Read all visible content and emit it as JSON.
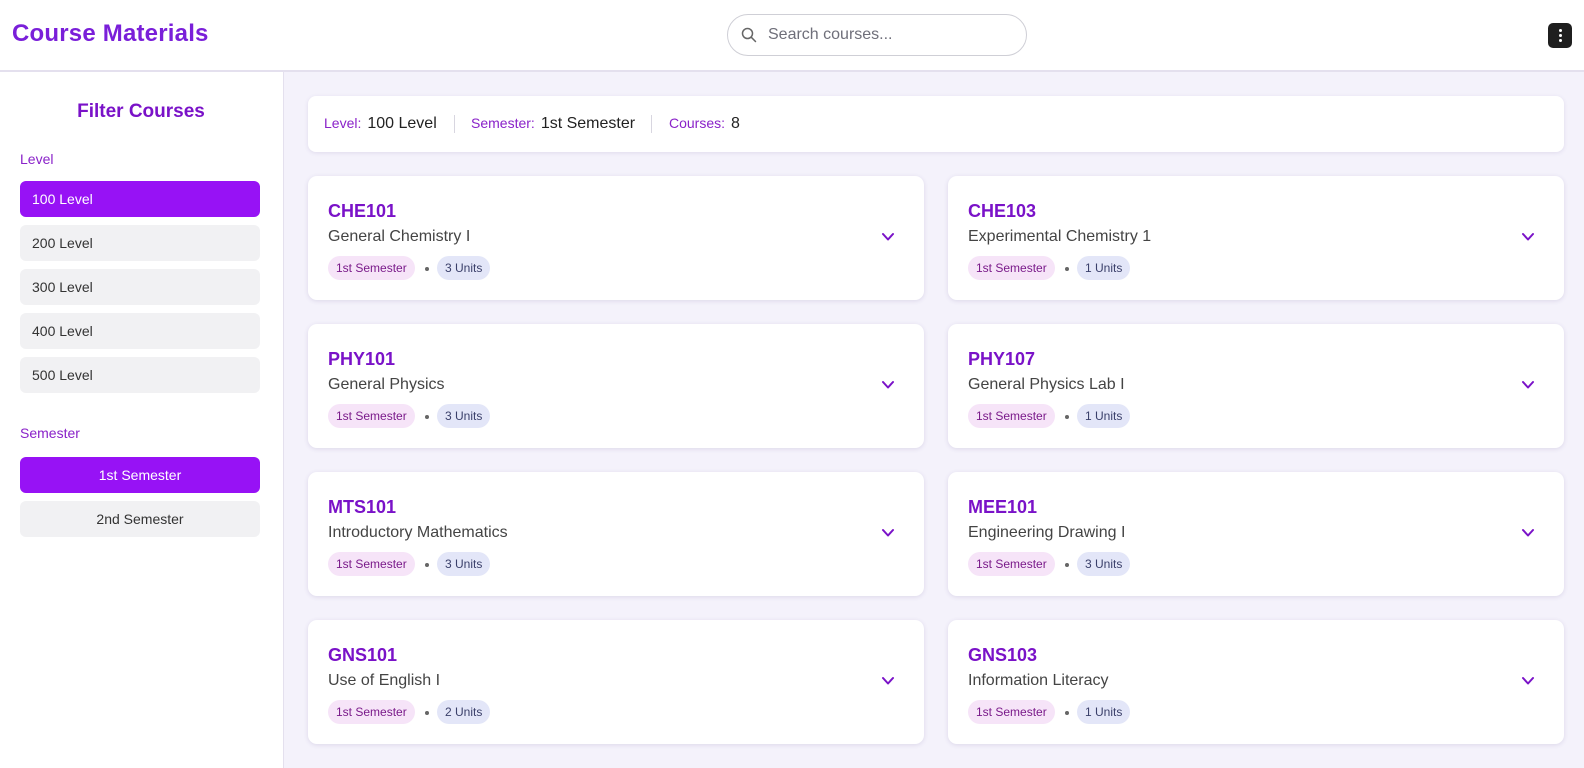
{
  "app": {
    "title": "Course Materials"
  },
  "search": {
    "placeholder": "Search courses..."
  },
  "sidebar": {
    "title": "Filter Courses",
    "level_label": "Level",
    "levels": [
      "100 Level",
      "200 Level",
      "300 Level",
      "400 Level",
      "500 Level"
    ],
    "selected_level": "100 Level",
    "semester_label": "Semester",
    "semesters": [
      "1st Semester",
      "2nd Semester"
    ],
    "selected_semester": "1st Semester"
  },
  "summary": {
    "level_key": "Level:",
    "level_value": "100 Level",
    "semester_key": "Semester:",
    "semester_value": "1st Semester",
    "courses_key": "Courses:",
    "courses_value": "8"
  },
  "courses": [
    {
      "code": "CHE101",
      "name": "General Chemistry I",
      "semester": "1st Semester",
      "units": "3 Units"
    },
    {
      "code": "CHE103",
      "name": "Experimental Chemistry 1",
      "semester": "1st Semester",
      "units": "1 Units"
    },
    {
      "code": "PHY101",
      "name": "General Physics",
      "semester": "1st Semester",
      "units": "3 Units"
    },
    {
      "code": "PHY107",
      "name": "General Physics Lab I",
      "semester": "1st Semester",
      "units": "1 Units"
    },
    {
      "code": "MTS101",
      "name": "Introductory Mathematics",
      "semester": "1st Semester",
      "units": "3 Units"
    },
    {
      "code": "MEE101",
      "name": "Engineering Drawing I",
      "semester": "1st Semester",
      "units": "3 Units"
    },
    {
      "code": "GNS101",
      "name": "Use of English I",
      "semester": "1st Semester",
      "units": "2 Units"
    },
    {
      "code": "GNS103",
      "name": "Information Literacy",
      "semester": "1st Semester",
      "units": "1 Units"
    }
  ],
  "colors": {
    "accent": "#9712f5",
    "brand": "#7a1fd9",
    "semester_badge_bg": "#f6e4f8",
    "units_badge_bg": "#e3e6f8"
  },
  "icons": {
    "search": "search-icon",
    "menu": "more-vertical-icon",
    "expand": "chevron-down-icon"
  }
}
